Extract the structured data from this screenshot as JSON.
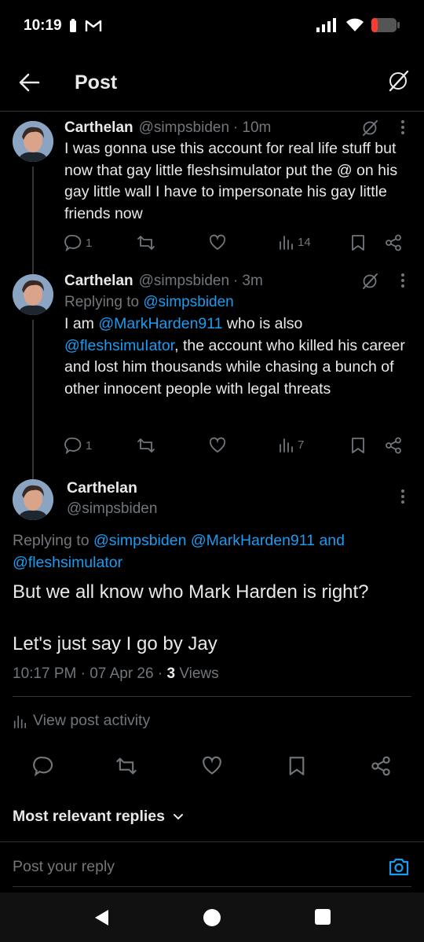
{
  "status_bar": {
    "time": "10:19",
    "icons": [
      "battery-saver-icon",
      "gmail-icon",
      "signal-icon",
      "wifi-icon",
      "battery-icon"
    ]
  },
  "header": {
    "title": "Post",
    "back_icon": "arrow-left-icon",
    "grok_icon": "grok-icon"
  },
  "thread": [
    {
      "name": "Carthelan",
      "handle": "@simpsbiden",
      "dot": "·",
      "time": "10m",
      "text": "I was gonna use this account for real life stuff but now that gay little fleshsimulator put the @ on his gay little wall I have to impersonate his gay little friends now",
      "replies": "1",
      "reposts": "",
      "likes": "",
      "views": "14"
    },
    {
      "name": "Carthelan",
      "handle": "@simpsbiden",
      "dot": "·",
      "time": "3m",
      "replying_prefix": "Replying to ",
      "replying_to": "@simpsbiden",
      "text_prefix": "I am ",
      "mention1": "@MarkHarden911",
      "text_mid": " who is also ",
      "mention2": "@fleshsimuIator",
      "text_suffix": ", the account who killed his career and lost him thousands while chasing a bunch of other innocent people with legal threats",
      "replies": "1",
      "reposts": "",
      "likes": "",
      "views": "7"
    }
  ],
  "main_post": {
    "name": "Carthelan",
    "handle": "@simpsbiden",
    "replying_prefix": "Replying to ",
    "replying_to_1": "@simpsbiden",
    "replying_to_2": "@MarkHarden911",
    "replying_and": "and",
    "replying_to_3": "@fleshsimulator",
    "text_line1": "But we all know who Mark Harden is right?",
    "text_line2": "Let's just say I go by Jay",
    "time": "10:17 PM",
    "dot": "·",
    "date": "07 Apr 26",
    "views_count": "3",
    "views_label": "Views",
    "activity_label": "View post activity"
  },
  "replies_sort": {
    "label": "Most relevant replies"
  },
  "reply_box": {
    "placeholder": "Post your reply"
  },
  "colors": {
    "background": "#000000",
    "text": "#e7e9ea",
    "muted": "#71767b",
    "link": "#1d9bf0",
    "divider": "#2f3336"
  }
}
